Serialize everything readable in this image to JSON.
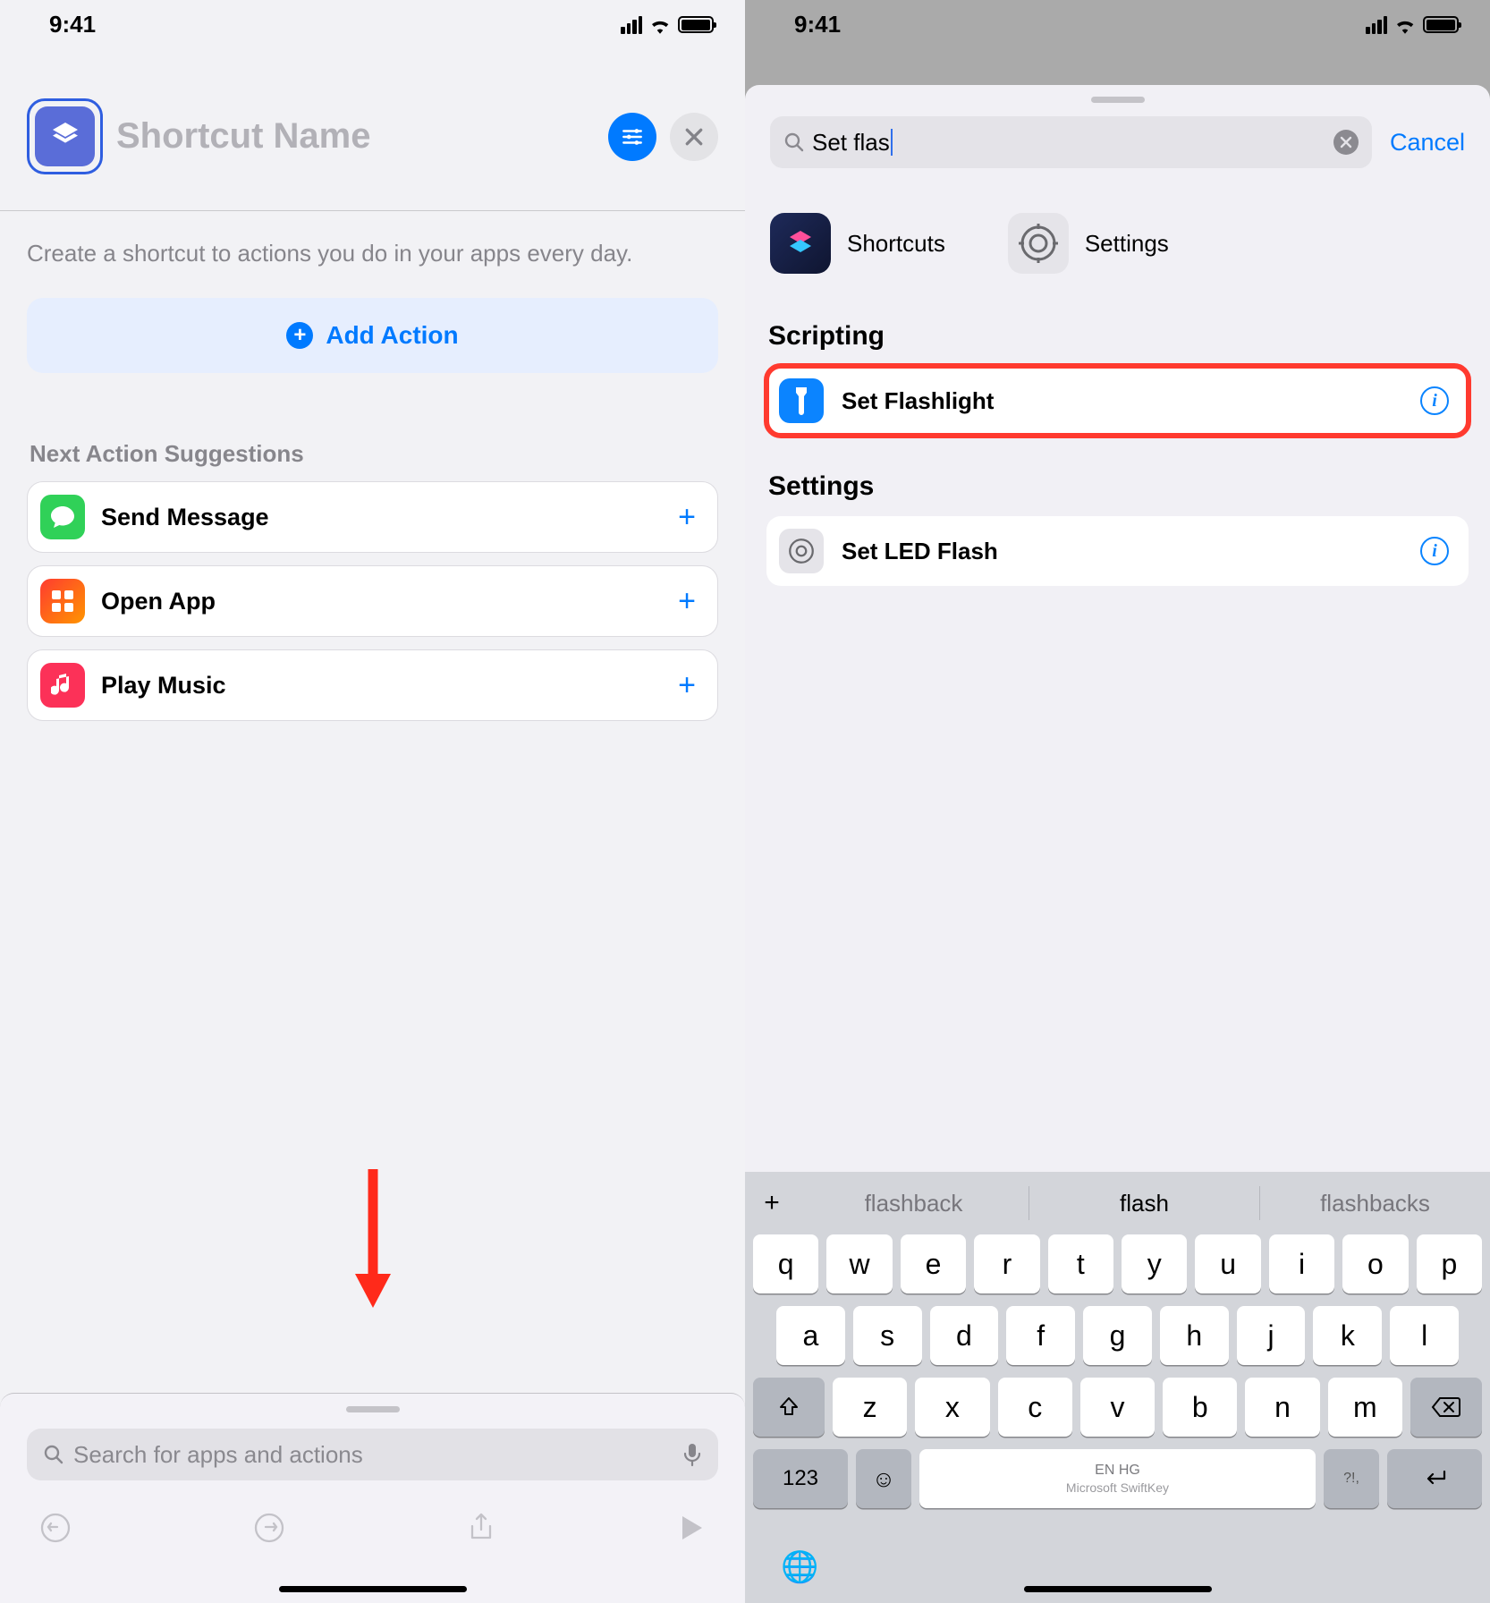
{
  "status": {
    "time": "9:41"
  },
  "left": {
    "title_placeholder": "Shortcut Name",
    "tip": "Create a shortcut to actions you do in your apps every day.",
    "add_action": "Add Action",
    "suggestions_header": "Next Action Suggestions",
    "suggestions": [
      {
        "label": "Send Message"
      },
      {
        "label": "Open App"
      },
      {
        "label": "Play Music"
      }
    ],
    "search_placeholder": "Search for apps and actions"
  },
  "right": {
    "search_value": "Set flas",
    "cancel": "Cancel",
    "apps": [
      {
        "label": "Shortcuts"
      },
      {
        "label": "Settings"
      }
    ],
    "sections": [
      {
        "header": "Scripting",
        "items": [
          {
            "label": "Set Flashlight",
            "highlighted": true
          }
        ]
      },
      {
        "header": "Settings",
        "items": [
          {
            "label": "Set LED Flash"
          }
        ]
      }
    ],
    "predictions": {
      "left": "flashback",
      "mid": "flash",
      "right": "flashbacks"
    },
    "keyboard": {
      "row1": [
        "q",
        "w",
        "e",
        "r",
        "t",
        "y",
        "u",
        "i",
        "o",
        "p"
      ],
      "row2": [
        "a",
        "s",
        "d",
        "f",
        "g",
        "h",
        "j",
        "k",
        "l"
      ],
      "row3": [
        "z",
        "x",
        "c",
        "v",
        "b",
        "n",
        "m"
      ],
      "k123": "123",
      "space1": "EN HG",
      "space2": "Microsoft SwiftKey",
      "sym": "?!,"
    }
  }
}
